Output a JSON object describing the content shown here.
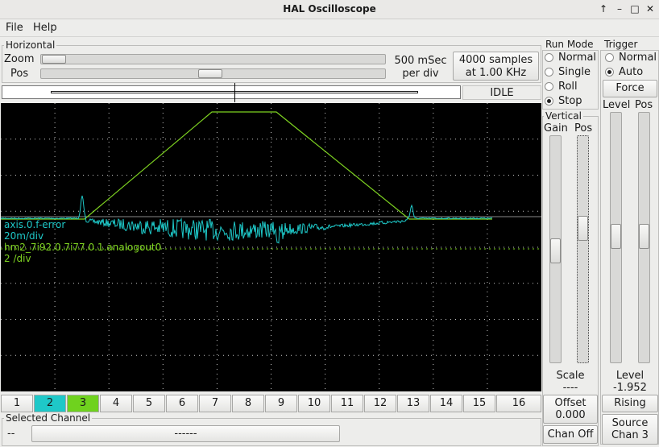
{
  "window": {
    "title": "HAL Oscilloscope"
  },
  "menu": {
    "file": "File",
    "help": "Help"
  },
  "horizontal": {
    "label": "Horizontal",
    "zoom_label": "Zoom",
    "pos_label": "Pos",
    "zoom_level": 0.0,
    "pos_level": 0.5,
    "time_line1": "500 mSec",
    "time_line2": "per div",
    "samples_line1": "4000 samples",
    "samples_line2": "at 1.00 KHz",
    "state": "IDLE"
  },
  "run_mode": {
    "label": "Run Mode",
    "options": [
      "Normal",
      "Single",
      "Roll",
      "Stop"
    ],
    "selected": "Stop"
  },
  "trigger": {
    "label": "Trigger",
    "options": [
      "Normal",
      "Auto"
    ],
    "selected": "Auto",
    "force": "Force",
    "level_label": "Level",
    "pos_label": "Pos",
    "level_title": "Level",
    "level_value": "-1.952",
    "edge": "Rising",
    "source_line1": "Source",
    "source_line2": "Chan  3"
  },
  "vertical": {
    "label": "Vertical",
    "gain_label": "Gain",
    "pos_label": "Pos",
    "scale_label": "Scale",
    "scale_value": "----",
    "offset_label": "Offset",
    "offset_value": "0.000",
    "chan_off": "Chan Off"
  },
  "channels": {
    "buttons": [
      "1",
      "2",
      "3",
      "4",
      "5",
      "6",
      "7",
      "8",
      "9",
      "10",
      "11",
      "12",
      "13",
      "14",
      "15",
      "16"
    ],
    "colors": {
      "2": "#1ec8c8",
      "3": "#6fd21e"
    }
  },
  "scope_labels": {
    "ch2_name": "axis.0.f-error",
    "ch2_scale": "20m/div",
    "ch3_name": "hm2_7i92.0.7i77.0.1.analogout0",
    "ch3_scale": "2 /div"
  },
  "selected_channel": {
    "label": "Selected Channel",
    "number": "--",
    "name": "------"
  },
  "colors": {
    "trace_cyan": "#1ec8c8",
    "trace_green": "#7ed321",
    "scope_bg": "#000000"
  }
}
